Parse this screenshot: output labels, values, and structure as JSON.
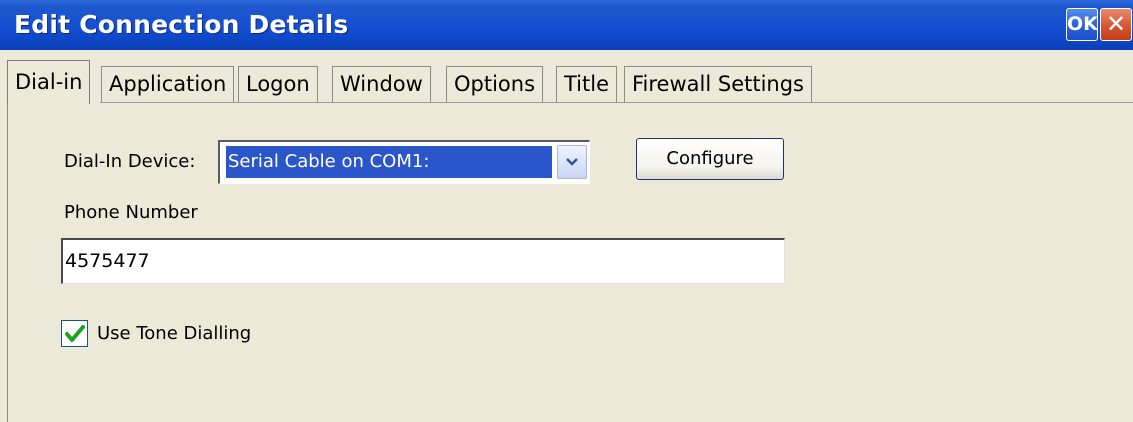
{
  "window": {
    "title": "Edit Connection Details",
    "ok_label": "OK",
    "close_symbol": "✕"
  },
  "tabs": [
    {
      "label": "Dial-in",
      "active": true
    },
    {
      "label": "Application",
      "active": false
    },
    {
      "label": "Logon",
      "active": false
    },
    {
      "label": "Window",
      "active": false
    },
    {
      "label": "Options",
      "active": false
    },
    {
      "label": "Title",
      "active": false
    },
    {
      "label": "Firewall Settings",
      "active": false
    }
  ],
  "dialin": {
    "device_label": "Dial-In Device:",
    "device_value": "Serial Cable on COM1:",
    "configure_label": "Configure",
    "phone_label": "Phone Number",
    "phone_value": "4575477",
    "tone_label": "Use Tone Dialling",
    "tone_checked": true
  },
  "colors": {
    "titlebar": "#1650d0",
    "background": "#ece9d8",
    "selection": "#2b56c9",
    "check": "#21a121"
  },
  "icons": {
    "close": "close-icon",
    "dropdown": "chevron-down-icon",
    "check": "checkmark-icon"
  }
}
